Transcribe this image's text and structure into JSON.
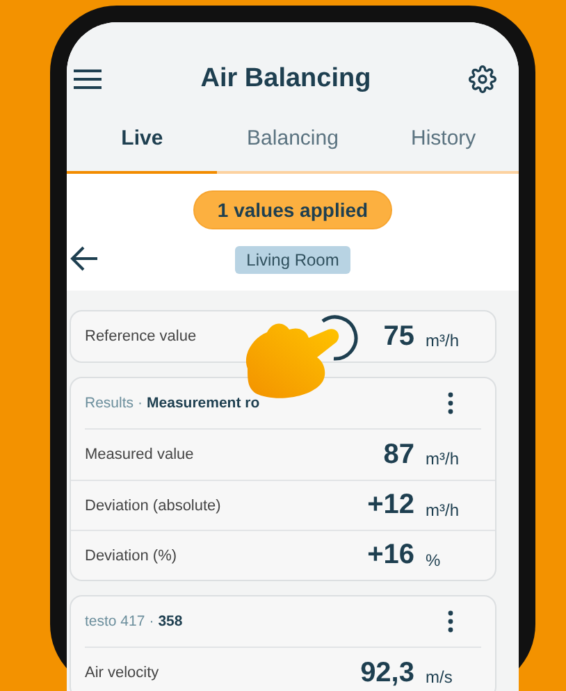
{
  "header": {
    "title": "Air Balancing"
  },
  "tabs": [
    {
      "label": "Live",
      "selected": true
    },
    {
      "label": "Balancing",
      "selected": false
    },
    {
      "label": "History",
      "selected": false
    }
  ],
  "status_pill": "1 values applied",
  "room_chip": "Living Room",
  "reference": {
    "label": "Reference value",
    "value": "75",
    "unit": "m³/h"
  },
  "cards": [
    {
      "source": "Results",
      "separator": "·",
      "name": "Measurement ro",
      "rows": [
        {
          "label": "Measured value",
          "value": "87",
          "unit": "m³/h"
        },
        {
          "label": "Deviation (absolute)",
          "value": "+12",
          "unit": "m³/h"
        },
        {
          "label": "Deviation (%)",
          "value": "+16",
          "unit": "%"
        }
      ]
    },
    {
      "source": "testo 417",
      "separator": "·",
      "name": "358",
      "rows": [
        {
          "label": "Air velocity",
          "value": "92,3",
          "unit": "m/s"
        }
      ]
    }
  ]
}
